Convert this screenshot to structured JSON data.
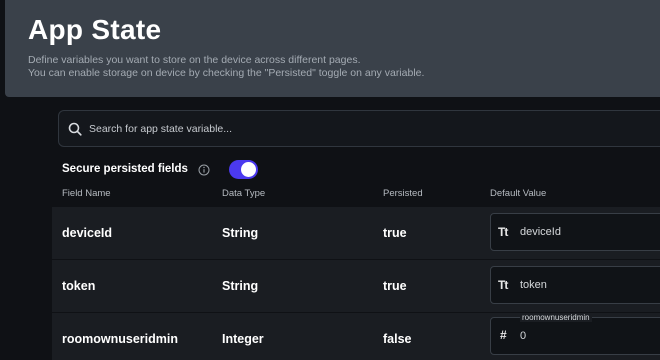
{
  "header": {
    "title": "App State",
    "subtitle_line1": "Define variables you want to store on the device across different pages.",
    "subtitle_line2": "You can enable storage on device by checking the \"Persisted\" toggle on any variable."
  },
  "search": {
    "placeholder": "Search for app state variable..."
  },
  "secure": {
    "label": "Secure persisted fields",
    "enabled": true,
    "accent_color": "#4b39ef"
  },
  "columns": {
    "field_name": "Field Name",
    "data_type": "Data Type",
    "persisted": "Persisted",
    "default_value": "Default Value"
  },
  "rows": [
    {
      "name": "deviceId",
      "type": "String",
      "persisted": "true",
      "type_icon": "Tt",
      "default_value": "deviceId",
      "default_label": ""
    },
    {
      "name": "token",
      "type": "String",
      "persisted": "true",
      "type_icon": "Tt",
      "default_value": "token",
      "default_label": ""
    },
    {
      "name": "roomownuseridmin",
      "type": "Integer",
      "persisted": "false",
      "type_icon": "#",
      "default_value": "0",
      "default_label": "roomownuseridmin"
    }
  ]
}
